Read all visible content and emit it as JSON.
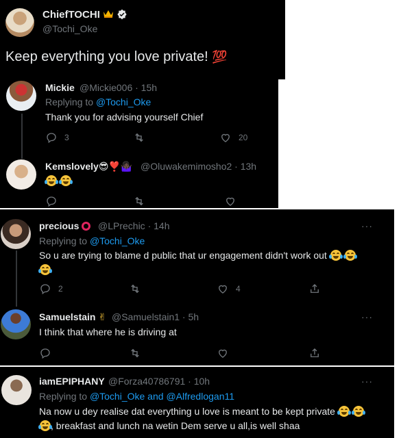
{
  "main_tweet": {
    "name": "ChiefTOCHI",
    "handle": "@Tochi_Oke",
    "text": "Keep everything you love private!",
    "hundred_emoji": "💯"
  },
  "replies": [
    {
      "name": "Mickie",
      "meta": "@Mickie006 · 15h",
      "replying_prefix": "Replying to ",
      "replying_to": "@Tochi_Oke",
      "text": "Thank you for advising yourself Chief",
      "reply_count": "3",
      "like_count": "20"
    },
    {
      "name": "Kemslovely",
      "name_emojis": "😎❣️🤷🏿‍♀️",
      "meta": "@Oluwakemimosho2 · 13h"
    },
    {
      "name": "precious",
      "meta": "@LPrechic · 14h",
      "replying_prefix": "Replying to ",
      "replying_to": "@Tochi_Oke",
      "text": "So u are trying to blame d public that ur engagement didn't work out",
      "reply_count": "2",
      "like_count": "4"
    },
    {
      "name": "Samuelstain",
      "name_emoji": "✌",
      "meta": "@Samuelstain1 · 5h",
      "text": "I think that where he is driving at"
    },
    {
      "name": "iamEPIPHANY",
      "meta": "@Forza40786791 · 10h",
      "replying_prefix": "Replying to ",
      "replying_to": "@Tochi_Oke",
      "replying_and": " and ",
      "replying_to_2": "@Alfredlogan11",
      "text_line1": "Na now u dey realise dat everything u love is meant to be kept private",
      "text_line2": ", breakfast and lunch na wetin Dem serve u all,is well shaa"
    }
  ],
  "more_label": "···",
  "icons": [
    "reply-icon",
    "retweet-icon",
    "like-icon",
    "share-icon",
    "verified-badge-icon",
    "crown-icon",
    "more-icon",
    "tears-of-joy-emoji"
  ],
  "colors": {
    "background": "#000000",
    "text": "#e7e9ea",
    "muted": "#71767b",
    "link": "#1d9bf0",
    "verified": "#e7e9ea"
  }
}
